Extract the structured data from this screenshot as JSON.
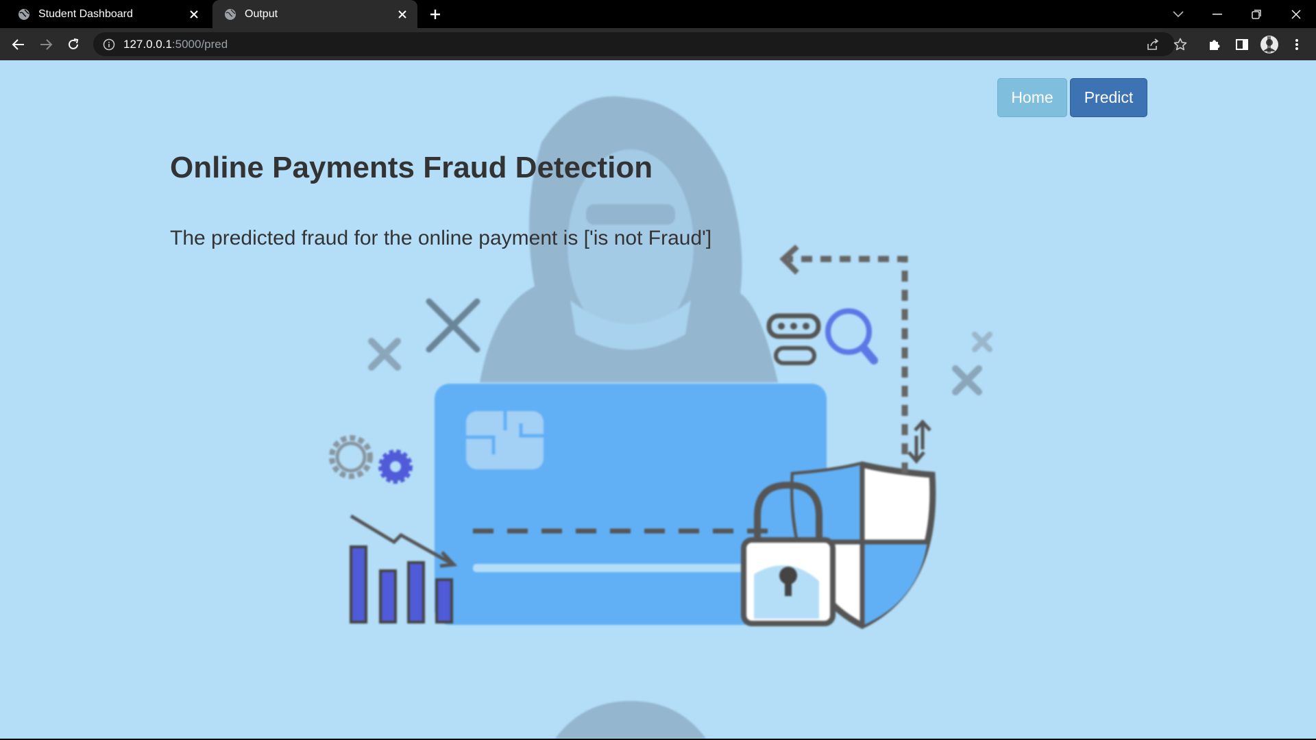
{
  "browser": {
    "tabs": [
      {
        "title": "Student Dashboard",
        "active": false
      },
      {
        "title": "Output",
        "active": true
      }
    ],
    "address": {
      "host": "127.0.0.1",
      "path": ":5000/pred"
    }
  },
  "page": {
    "nav": {
      "home_label": "Home",
      "predict_label": "Predict"
    },
    "heading": "Online Payments Fraud Detection",
    "result_text": "The predicted fraud for the online payment is ['is not Fraud']"
  },
  "colors": {
    "page_background": "#b4def7",
    "home_button": "#7fbedd",
    "predict_button": "#3d73b3",
    "card": "#61b0f5",
    "heading_text": "#333333"
  },
  "icons": {
    "tab_favicon": "globe-icon",
    "back": "arrow-left-icon",
    "forward": "arrow-right-icon",
    "reload": "reload-icon",
    "share": "share-icon",
    "bookmark": "star-icon",
    "extensions": "puzzle-icon",
    "sidepanel": "side-panel-icon",
    "profile": "avatar-icon",
    "menu": "kebab-menu-icon"
  }
}
